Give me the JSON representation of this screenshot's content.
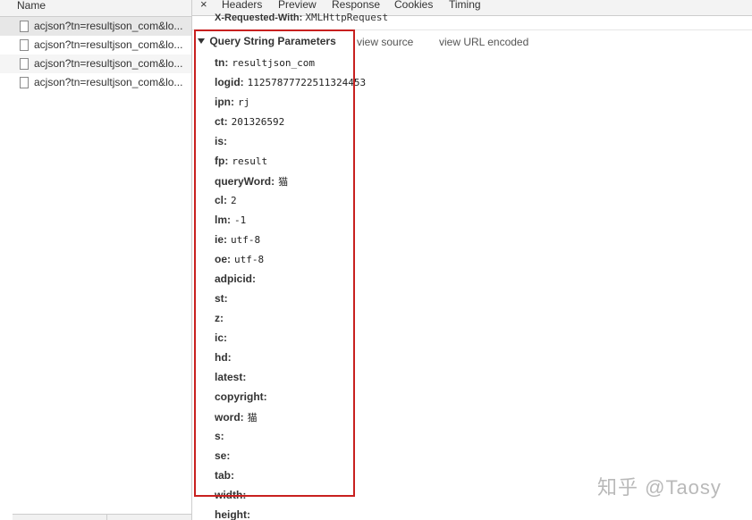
{
  "request_list": {
    "header": "Name",
    "rows": [
      {
        "label": "acjson?tn=resultjson_com&lo..."
      },
      {
        "label": "acjson?tn=resultjson_com&lo..."
      },
      {
        "label": "acjson?tn=resultjson_com&lo..."
      },
      {
        "label": "acjson?tn=resultjson_com&lo..."
      }
    ]
  },
  "tabs": {
    "close": "×",
    "items": [
      "Headers",
      "Preview",
      "Response",
      "Cookies",
      "Timing"
    ]
  },
  "cutoff_header": {
    "key": "X-Requested-With:",
    "value": "XMLHttpRequest"
  },
  "query_section": {
    "title": "Query String Parameters",
    "view_source": "view source",
    "view_url_encoded": "view URL encoded",
    "params": [
      {
        "key": "tn:",
        "value": "resultjson_com"
      },
      {
        "key": "logid:",
        "value": "11257877722511324453"
      },
      {
        "key": "ipn:",
        "value": "rj"
      },
      {
        "key": "ct:",
        "value": "201326592"
      },
      {
        "key": "is:",
        "value": ""
      },
      {
        "key": "fp:",
        "value": "result"
      },
      {
        "key": "queryWord:",
        "value": "猫"
      },
      {
        "key": "cl:",
        "value": "2"
      },
      {
        "key": "lm:",
        "value": "-1"
      },
      {
        "key": "ie:",
        "value": "utf-8"
      },
      {
        "key": "oe:",
        "value": "utf-8"
      },
      {
        "key": "adpicid:",
        "value": ""
      },
      {
        "key": "st:",
        "value": ""
      },
      {
        "key": "z:",
        "value": ""
      },
      {
        "key": "ic:",
        "value": ""
      },
      {
        "key": "hd:",
        "value": ""
      },
      {
        "key": "latest:",
        "value": ""
      },
      {
        "key": "copyright:",
        "value": ""
      },
      {
        "key": "word:",
        "value": "猫"
      },
      {
        "key": "s:",
        "value": ""
      },
      {
        "key": "se:",
        "value": ""
      },
      {
        "key": "tab:",
        "value": ""
      },
      {
        "key": "width:",
        "value": ""
      },
      {
        "key": "height:",
        "value": ""
      }
    ]
  },
  "watermark": "知乎 @Taosy",
  "colors": {
    "highlight": "#c8201f",
    "selected_row": "#e7e7e7"
  }
}
